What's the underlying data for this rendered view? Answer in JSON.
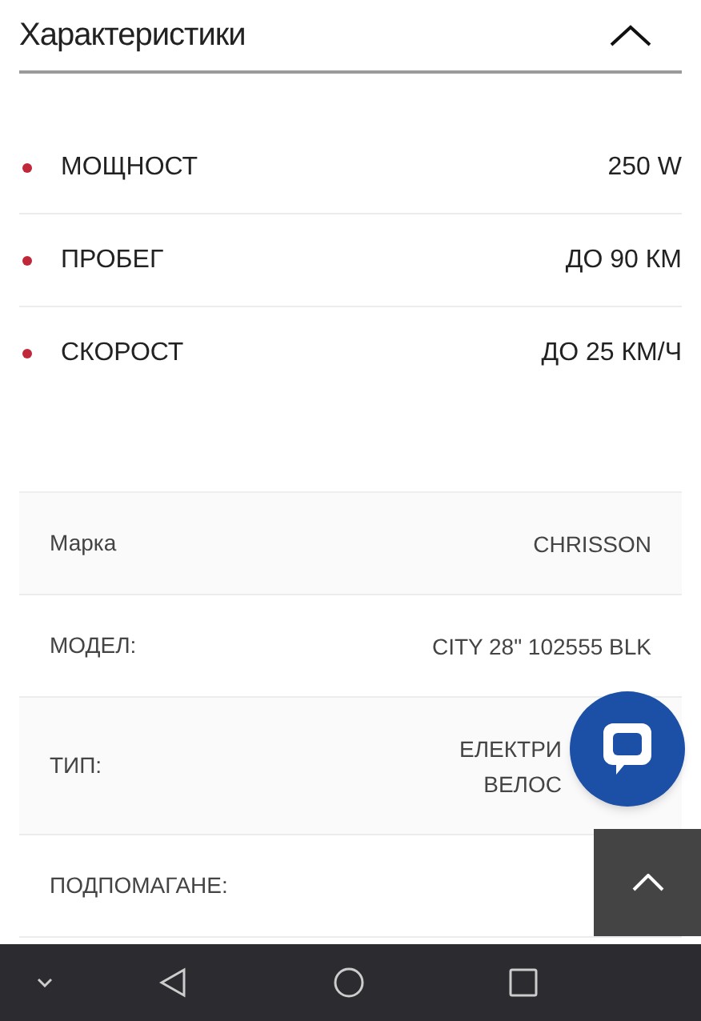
{
  "section": {
    "title": "Характеристики",
    "expanded": true
  },
  "highlights": [
    {
      "label": "МОЩНОСТ",
      "value": "250 W"
    },
    {
      "label": "ПРОБЕГ",
      "value": "ДО 90 КМ"
    },
    {
      "label": "СКОРОСТ",
      "value": "ДО 25 КМ/Ч"
    }
  ],
  "specs": [
    {
      "label": "Марка",
      "value": [
        "CHRISSON"
      ]
    },
    {
      "label": "МОДЕЛ:",
      "value": [
        "CITY 28\" 102555 BLK"
      ]
    },
    {
      "label": "ТИП:",
      "value": [
        "ЕЛЕКТРИ",
        "ВЕЛОС"
      ]
    },
    {
      "label": "ПОДПОМАГАНЕ:"
    }
  ]
}
